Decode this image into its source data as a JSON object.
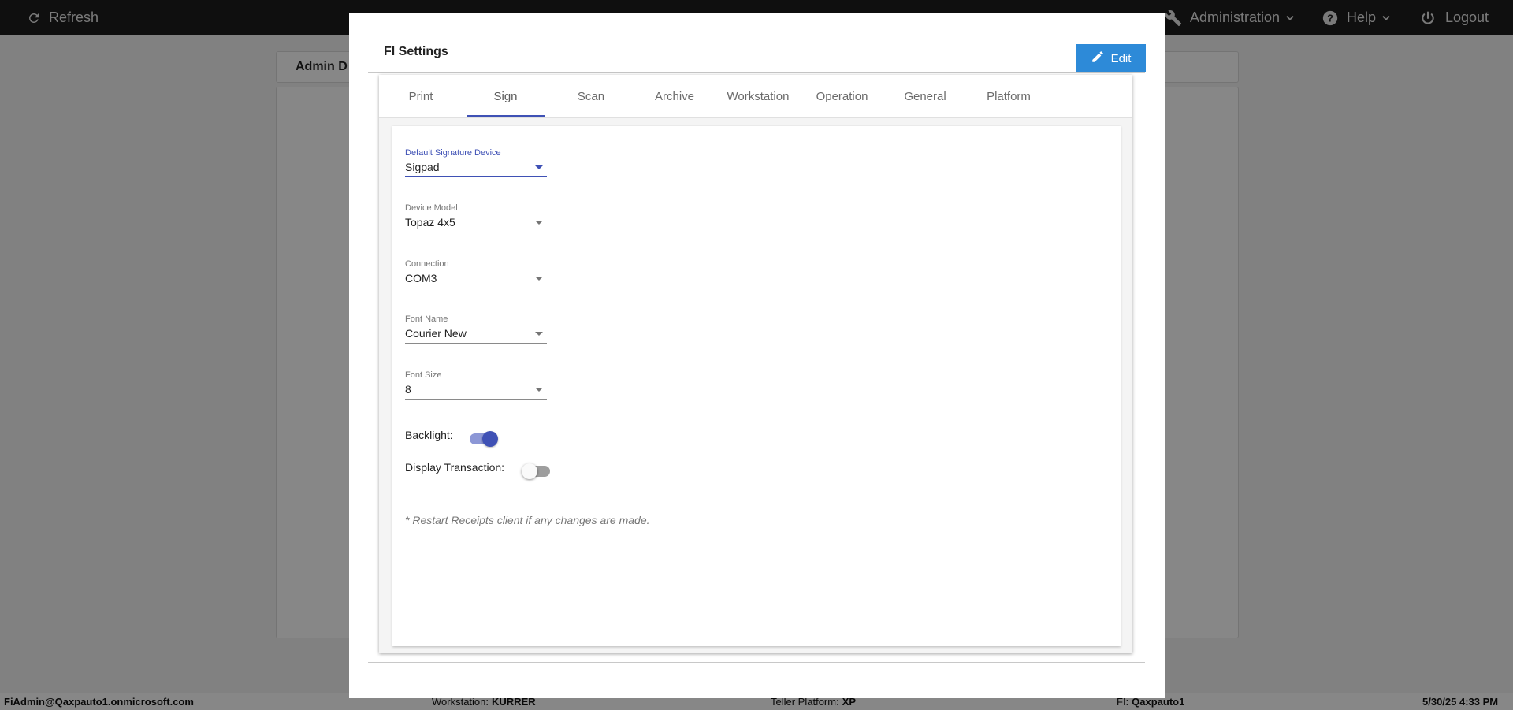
{
  "topbar": {
    "refresh_label": "Refresh",
    "administration_label": "Administration",
    "help_label": "Help",
    "logout_label": "Logout"
  },
  "background": {
    "header_title": "Admin D"
  },
  "statusbar": {
    "user": "FiAdmin@Qaxpauto1.onmicrosoft.com",
    "workstation_label": "Workstation:",
    "workstation_value": "KURRER",
    "teller_platform_label": "Teller Platform:",
    "teller_platform_value": "XP",
    "fi_label": "FI:",
    "fi_value": "Qaxpauto1",
    "datetime": "5/30/25 4:33 PM"
  },
  "modal": {
    "title": "FI Settings",
    "edit_label": "Edit",
    "tabs": [
      {
        "label": "Print",
        "active": false
      },
      {
        "label": "Sign",
        "active": true
      },
      {
        "label": "Scan",
        "active": false
      },
      {
        "label": "Archive",
        "active": false
      },
      {
        "label": "Workstation",
        "active": false
      },
      {
        "label": "Operation",
        "active": false
      },
      {
        "label": "General",
        "active": false
      },
      {
        "label": "Platform",
        "active": false
      }
    ],
    "fields": [
      {
        "label": "Default Signature Device",
        "value": "Sigpad",
        "focused": true
      },
      {
        "label": "Device Model",
        "value": "Topaz 4x5",
        "focused": false
      },
      {
        "label": "Connection",
        "value": "COM3",
        "focused": false
      },
      {
        "label": "Font Name",
        "value": "Courier New",
        "focused": false
      },
      {
        "label": "Font Size",
        "value": "8",
        "focused": false
      }
    ],
    "toggles": [
      {
        "label": "Backlight:",
        "on": true
      },
      {
        "label": "Display Transaction:",
        "on": false
      }
    ],
    "note": "* Restart Receipts client if any changes are made."
  },
  "colors": {
    "accent": "#3f51b5",
    "edit_button": "#2d8ad8",
    "topbar": "#1e1e1e"
  }
}
